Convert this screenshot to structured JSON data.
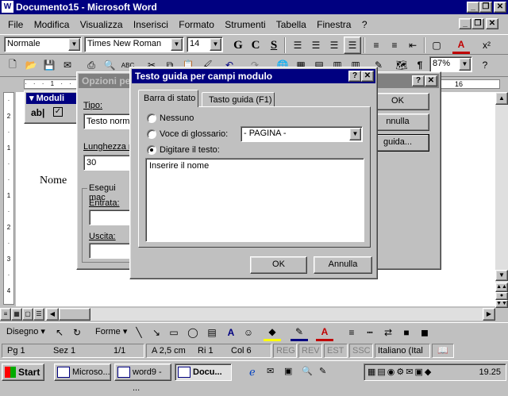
{
  "window": {
    "title": "Documento15 - Microsoft Word"
  },
  "menu": [
    "File",
    "Modifica",
    "Visualizza",
    "Inserisci",
    "Formato",
    "Strumenti",
    "Tabella",
    "Finestra",
    "?"
  ],
  "format_toolbar": {
    "style": "Normale",
    "font": "Times New Roman",
    "size": "14",
    "bold": "G",
    "italic": "C",
    "underline": "S"
  },
  "standard_toolbar": {
    "zoom": "87%"
  },
  "ruler": {
    "right_mark": "16"
  },
  "document": {
    "text": "Nome"
  },
  "forms_toolbar": {
    "title": "Moduli",
    "ab": "ab|"
  },
  "opzioni_dialog": {
    "title": "Opzioni per",
    "tipo_label": "Tipo:",
    "tipo_value": "Testo norm",
    "lunghezza_label": "Lunghezza m",
    "lunghezza_value": "30",
    "esegui_label": "Esegui mac",
    "entrata_label": "Entrata:",
    "uscita_label": "Uscita:",
    "ok": "OK",
    "annulla": "nnulla",
    "guida": "guida..."
  },
  "help_dialog": {
    "title": "Testo guida per campi modulo",
    "tabs": [
      "Barra di stato",
      "Tasto guida (F1)"
    ],
    "radio_nessuno": "Nessuno",
    "radio_voce": "Voce di glossario:",
    "voce_value": "- PAGINA -",
    "radio_digitare": "Digitare il testo:",
    "text_value": "Inserire il nome",
    "ok": "OK",
    "annulla": "Annulla"
  },
  "drawing_toolbar": {
    "disegno": "Disegno",
    "forme": "Forme"
  },
  "status": {
    "pg": "Pg 1",
    "sez": "Sez 1",
    "pages": "1/1",
    "pos": "A 2,5 cm",
    "ri": "Ri 1",
    "col": "Col 6",
    "reg": "REG",
    "rev": "REV",
    "est": "EST",
    "ssc": "SSC",
    "lang": "Italiano (Ital"
  },
  "taskbar": {
    "start": "Start",
    "tasks": [
      "Microso...",
      "word9 - ...",
      "Docu..."
    ],
    "clock": "19.25"
  }
}
